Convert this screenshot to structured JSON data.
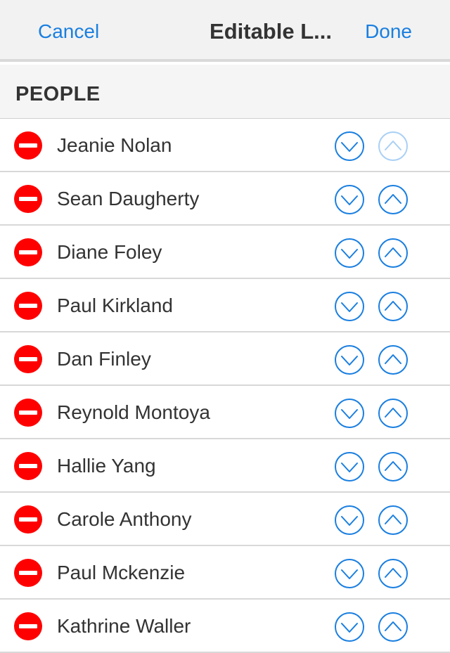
{
  "navbar": {
    "cancel_label": "Cancel",
    "title": "Editable L...",
    "done_label": "Done"
  },
  "section": {
    "title": "PEOPLE"
  },
  "people": [
    {
      "name": "Jeanie Nolan",
      "up_enabled": false
    },
    {
      "name": "Sean Daugherty",
      "up_enabled": true
    },
    {
      "name": "Diane Foley",
      "up_enabled": true
    },
    {
      "name": "Paul Kirkland",
      "up_enabled": true
    },
    {
      "name": "Dan Finley",
      "up_enabled": true
    },
    {
      "name": "Reynold Montoya",
      "up_enabled": true
    },
    {
      "name": "Hallie Yang",
      "up_enabled": true
    },
    {
      "name": "Carole Anthony",
      "up_enabled": true
    },
    {
      "name": "Paul Mckenzie",
      "up_enabled": true
    },
    {
      "name": "Kathrine Waller",
      "up_enabled": true
    }
  ],
  "colors": {
    "accent": "#1a7fe0",
    "accent_disabled": "#a9d0f5",
    "delete": "#ff0000"
  },
  "icons": {
    "delete": "minus-circle-icon",
    "move_down": "chevron-down-circle-icon",
    "move_up": "chevron-up-circle-icon"
  }
}
